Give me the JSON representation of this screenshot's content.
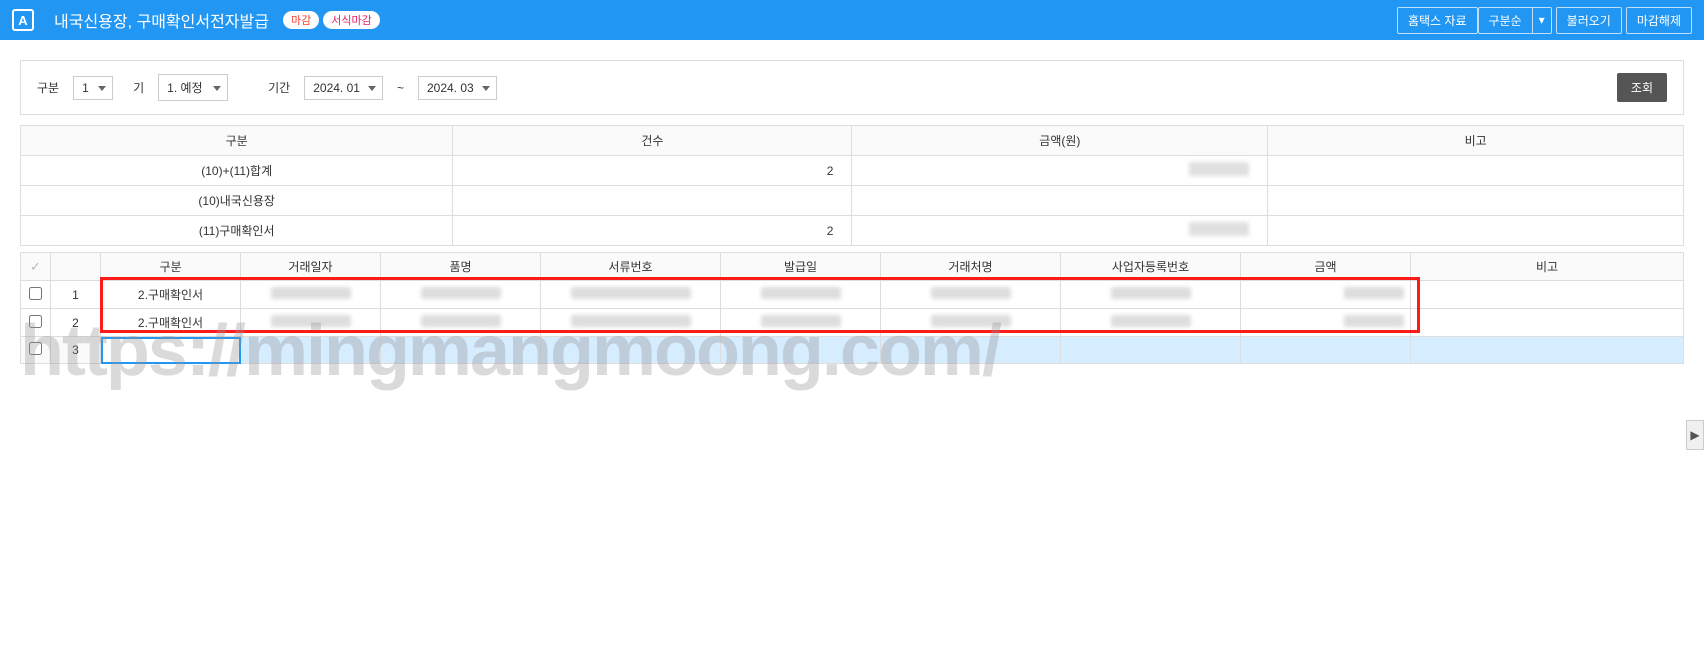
{
  "header": {
    "app_icon_letter": "A",
    "title": "내국신용장, 구매확인서전자발급",
    "badge1": "마감",
    "badge2": "서식마감",
    "btn_hometax": "홈택스 자료",
    "btn_sort": "구분순",
    "btn_load": "불러오기",
    "btn_unlock": "마감해제"
  },
  "filter": {
    "label_gubun": "구분",
    "gubun_value": "1",
    "label_gi": "기",
    "gi_value": "1. 예정",
    "label_period": "기간",
    "period_from": "2024. 01",
    "period_to": "2024. 03",
    "period_sep": "~",
    "btn_search": "조회"
  },
  "summary": {
    "headers": {
      "gubun": "구분",
      "count": "건수",
      "amount": "금액(원)",
      "note": "비고"
    },
    "rows": [
      {
        "label": "(10)+(11)합계",
        "count": "2",
        "amount": "",
        "note": ""
      },
      {
        "label": "(10)내국신용장",
        "count": "",
        "amount": "",
        "note": ""
      },
      {
        "label": "(11)구매확인서",
        "count": "2",
        "amount": "",
        "note": ""
      }
    ]
  },
  "detail": {
    "headers": {
      "gubun": "구분",
      "date": "거래일자",
      "item": "품명",
      "docno": "서류번호",
      "issue": "발급일",
      "vendor": "거래처명",
      "bizno": "사업자등록번호",
      "amount": "금액",
      "note": "비고"
    },
    "rows": [
      {
        "idx": "1",
        "gubun": "2.구매확인서"
      },
      {
        "idx": "2",
        "gubun": "2.구매확인서"
      },
      {
        "idx": "3",
        "gubun": ""
      }
    ]
  },
  "watermark": "https://mingmangmoong.com/"
}
